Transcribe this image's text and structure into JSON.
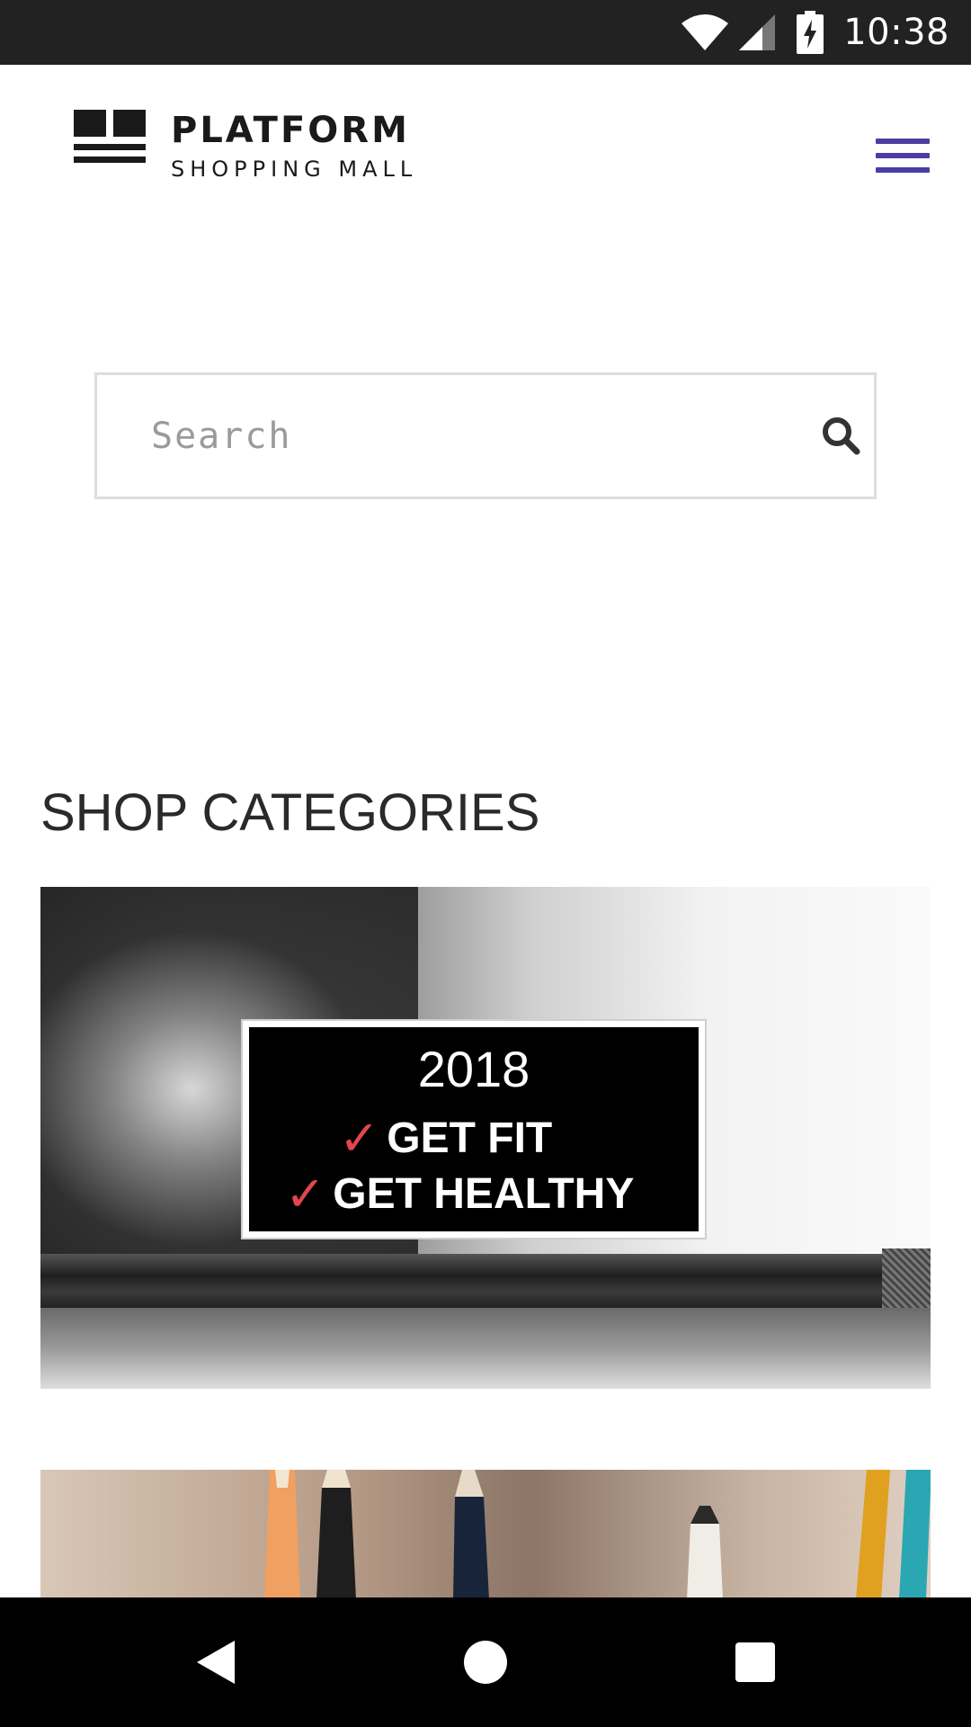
{
  "status_bar": {
    "time": "10:38",
    "icons": [
      "wifi-icon",
      "cell-signal-icon",
      "battery-charging-icon"
    ]
  },
  "header": {
    "logo_title": "PLATFORM",
    "logo_subtitle": "SHOPPING MALL",
    "menu_icon": "hamburger-menu-icon",
    "accent_color": "#4a3fa0"
  },
  "search": {
    "placeholder": "Search",
    "value": "",
    "icon": "search-icon"
  },
  "shop_categories": {
    "title": "SHOP CATEGORIES",
    "cards": [
      {
        "image": "fitness-barbell-photo",
        "promo_year": "2018",
        "promo_lines": [
          "GET FIT",
          "GET HEALTHY"
        ],
        "check_color": "#e0474c"
      },
      {
        "image": "colored-pencils-photo"
      }
    ]
  },
  "nav_bar": {
    "buttons": [
      "back-icon",
      "home-icon",
      "recents-icon"
    ]
  }
}
